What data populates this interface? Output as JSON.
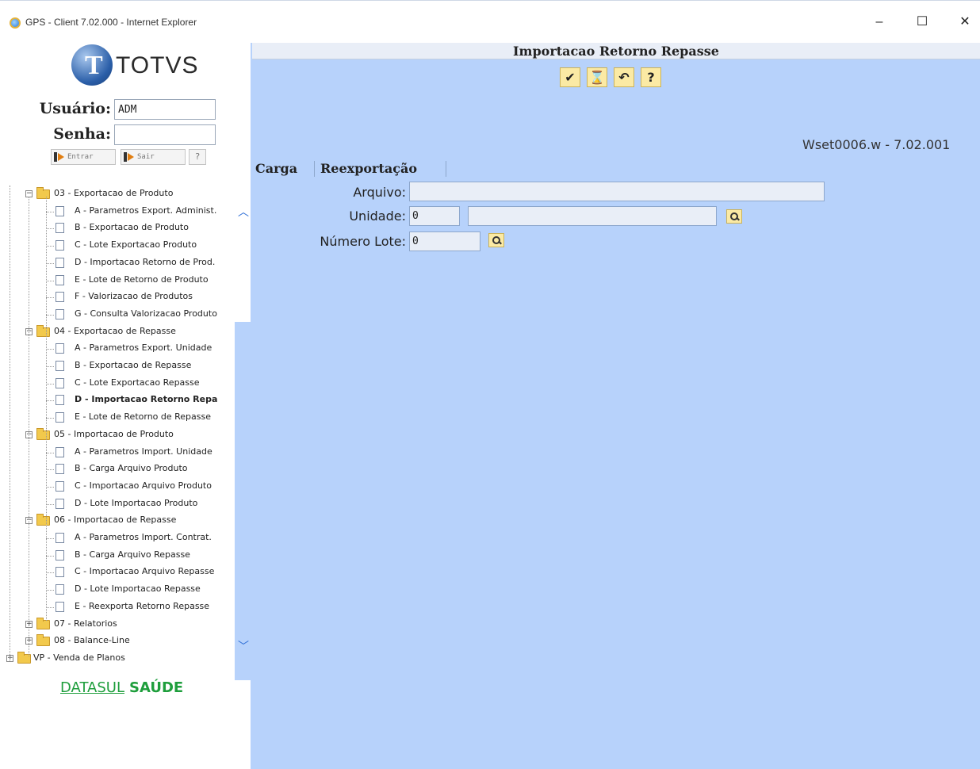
{
  "window": {
    "title": "GPS - Client 7.02.000 - Internet Explorer",
    "minimize": "–",
    "maximize": "☐",
    "close": "✕"
  },
  "login": {
    "logo_letter": "T",
    "logo_text": "TOTVS",
    "user_label": "Usuário:",
    "user_value": "ADM",
    "password_label": "Senha:",
    "password_value": "",
    "enter_label": "Entrar",
    "exit_label": "Sair",
    "help_label": "?"
  },
  "tree": {
    "items": [
      {
        "label": "03 - Exportacao de Produto",
        "kind": "folder"
      },
      {
        "label": "A - Parametros Export. Administ.",
        "kind": "doc"
      },
      {
        "label": "B - Exportacao de Produto",
        "kind": "doc"
      },
      {
        "label": "C - Lote Exportacao Produto",
        "kind": "doc"
      },
      {
        "label": "D - Importacao Retorno de Prod.",
        "kind": "doc"
      },
      {
        "label": "E - Lote de Retorno de Produto",
        "kind": "doc"
      },
      {
        "label": "F - Valorizacao de Produtos",
        "kind": "doc"
      },
      {
        "label": "G - Consulta Valorizacao Produto",
        "kind": "doc"
      },
      {
        "label": "04 - Exportacao de Repasse",
        "kind": "folder"
      },
      {
        "label": "A - Parametros Export. Unidade",
        "kind": "doc"
      },
      {
        "label": "B - Exportacao de Repasse",
        "kind": "doc"
      },
      {
        "label": "C - Lote Exportacao Repasse",
        "kind": "doc"
      },
      {
        "label": "D - Importacao Retorno Repa",
        "kind": "doc",
        "selected": true
      },
      {
        "label": "E - Lote de Retorno de Repasse",
        "kind": "doc"
      },
      {
        "label": "05 - Importacao de Produto",
        "kind": "folder"
      },
      {
        "label": "A - Parametros Import. Unidade",
        "kind": "doc"
      },
      {
        "label": "B - Carga Arquivo Produto",
        "kind": "doc"
      },
      {
        "label": "C - Importacao Arquivo Produto",
        "kind": "doc"
      },
      {
        "label": "D - Lote Importacao Produto",
        "kind": "doc"
      },
      {
        "label": "06 - Importacao de Repasse",
        "kind": "folder"
      },
      {
        "label": "A - Parametros Import. Contrat.",
        "kind": "doc"
      },
      {
        "label": "B - Carga Arquivo Repasse",
        "kind": "doc"
      },
      {
        "label": "C - Importacao Arquivo Repasse",
        "kind": "doc"
      },
      {
        "label": "D - Lote Importacao Repasse",
        "kind": "doc"
      },
      {
        "label": "E - Reexporta Retorno Repasse",
        "kind": "doc"
      },
      {
        "label": "07 - Relatorios",
        "kind": "folder-collapsed"
      },
      {
        "label": "08 - Balance-Line",
        "kind": "folder-collapsed"
      },
      {
        "label": "VP - Venda de Planos",
        "kind": "folder-collapsed-root"
      }
    ]
  },
  "footer_brand": {
    "part1": "DATASUL",
    "part2": "SAÚDE"
  },
  "main": {
    "title": "Importacao Retorno Repasse",
    "toolbar": {
      "confirm": "✔",
      "hourglass": "⌛",
      "undo": "↶",
      "help": "?"
    },
    "version": "Wset0006.w - 7.02.001",
    "tabs": [
      {
        "label": "Carga"
      },
      {
        "label": "Reexportação"
      }
    ],
    "form": {
      "arquivo_label": "Arquivo:",
      "arquivo_value": "",
      "unidade_label": "Unidade:",
      "unidade_value": "0",
      "unidade_desc": "",
      "lote_label": "Número Lote:",
      "lote_value": "0"
    }
  }
}
